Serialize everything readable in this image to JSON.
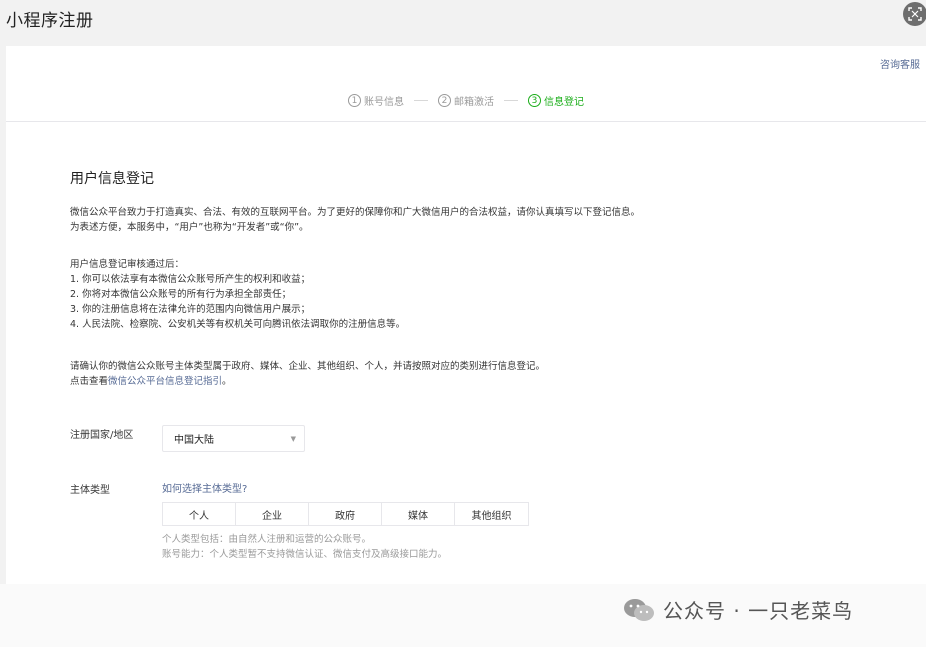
{
  "header": {
    "title": "小程序注册"
  },
  "help_link": "咨询客服",
  "steps": [
    {
      "num": "1",
      "label": "账号信息"
    },
    {
      "num": "2",
      "label": "邮箱激活"
    },
    {
      "num": "3",
      "label": "信息登记"
    }
  ],
  "section": {
    "title": "用户信息登记",
    "intro_1": "微信公众平台致力于打造真实、合法、有效的互联网平台。为了更好的保障你和广大微信用户的合法权益，请你认真填写以下登记信息。",
    "intro_2": "为表述方便，本服务中，“用户”也称为“开发者”或“你”。",
    "after_title": "用户信息登记审核通过后：",
    "rules": [
      "1. 你可以依法享有本微信公众账号所产生的权利和收益；",
      "2. 你将对本微信公众账号的所有行为承担全部责任；",
      "3. 你的注册信息将在法律允许的范围内向微信用户展示；",
      "4. 人民法院、检察院、公安机关等有权机关可向腾讯依法调取你的注册信息等。"
    ],
    "confirm": "请确认你的微信公众账号主体类型属于政府、媒体、企业、其他组织、个人，并请按照对应的类别进行信息登记。",
    "guide_prefix": "点击查看",
    "guide_link": "微信公众平台信息登记指引",
    "guide_suffix": "。"
  },
  "form": {
    "region_label": "注册国家/地区",
    "region_value": "中国大陆",
    "type_label": "主体类型",
    "type_help": "如何选择主体类型?",
    "types": [
      "个人",
      "企业",
      "政府",
      "媒体",
      "其他组织"
    ],
    "type_note_1": "个人类型包括：由自然人注册和运营的公众账号。",
    "type_note_2": "账号能力：个人类型暂不支持微信认证、微信支付及高级接口能力。"
  },
  "watermark": "公众号 · 一只老菜鸟",
  "icons": {
    "scan": "scan-icon",
    "select_arrow": "chevron-down-icon",
    "watermark": "wechat-icon"
  },
  "colors": {
    "accent_green": "#1aad19",
    "link_blue": "#576b95"
  }
}
